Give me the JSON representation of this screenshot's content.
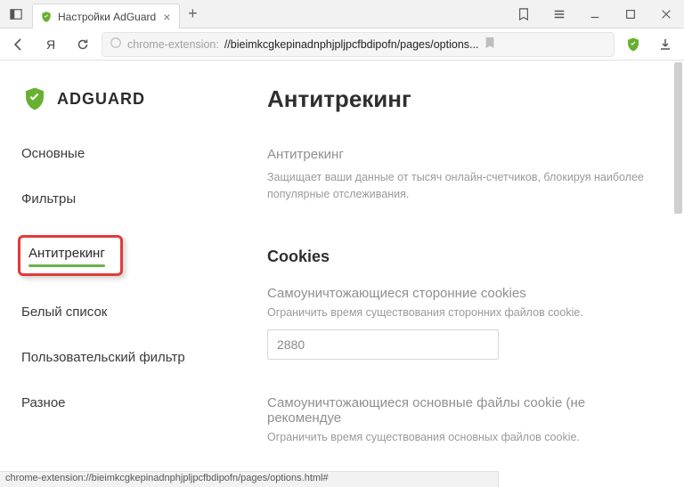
{
  "browser": {
    "tab_title": "Настройки AdGuard",
    "addr_prefix": "chrome-extension:",
    "addr_rest": "//bieimkcgkepinadnphjpljpcfbdipofn/pages/options...",
    "status_url": "chrome-extension://bieimkcgkepinadnphjpljpcfbdipofn/pages/options.html#"
  },
  "app": {
    "brand": "ADGUARD"
  },
  "sidebar": {
    "items": [
      {
        "label": "Основные"
      },
      {
        "label": "Фильтры"
      },
      {
        "label": "Антитрекинг",
        "active": true
      },
      {
        "label": "Белый список"
      },
      {
        "label": "Пользовательский фильтр"
      },
      {
        "label": "Разное"
      }
    ]
  },
  "content": {
    "title": "Антитрекинг",
    "intro_label": "Антитрекинг",
    "intro_desc": "Защищает ваши данные от тысяч онлайн-счетчиков, блокируя наиболее популярные отслеживания.",
    "cookies_heading": "Cookies",
    "third_party": {
      "label": "Самоуничтожающиеся сторонние cookies",
      "desc": "Ограничить время существования сторонних файлов cookie.",
      "value": "2880"
    },
    "first_party": {
      "label": "Самоуничтожающиеся основные файлы cookie (не рекомендуе",
      "desc": "Ограничить время существования основных файлов cookie."
    }
  },
  "colors": {
    "accent": "#68b030",
    "highlight": "#e23a3a"
  }
}
